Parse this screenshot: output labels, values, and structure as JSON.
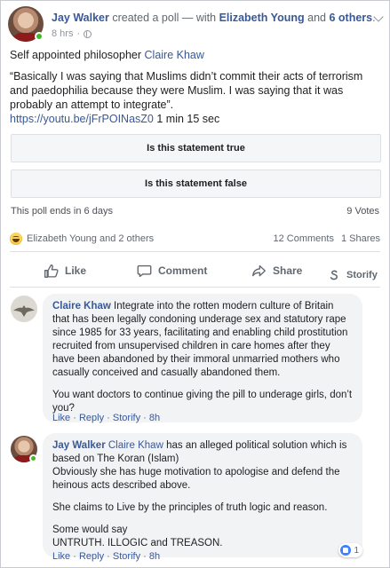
{
  "post": {
    "author": "Jay Walker",
    "action_text": "created a poll — with",
    "tagged_person": "Elizabeth Young",
    "and_text": "and",
    "tagged_others": "6 others",
    "period": ".",
    "time": "8 hrs",
    "separator": "·",
    "intro_text": "Self appointed philosopher",
    "intro_mention": "Claire Khaw",
    "quote": "“Basically I was saying that Muslims didn’t commit their acts of terrorism and paedophilia because they were Muslim. I was saying that it was probably an attempt to integrate”.",
    "link": "https://youtu.be/jFrPOINasZ0",
    "duration": "1 min 15 sec"
  },
  "poll": {
    "options": [
      "Is this statement true",
      "Is this statement false"
    ],
    "ends_text": "This poll ends in 6 days",
    "votes": "9 Votes"
  },
  "reactions": {
    "names": "Elizabeth Young and 2 others",
    "comments": "12 Comments",
    "shares": "1 Shares"
  },
  "actions": {
    "like": "Like",
    "comment": "Comment",
    "share": "Share",
    "storify": "Storify"
  },
  "comments": [
    {
      "author": "Claire Khaw",
      "text": "Integrate into the rotten modern culture of Britain that has been legally condoning underage sex and statutory rape since 1985 for 33 years, facilitating and enabling child prostitution recruited from unsupervised children in care homes after they have been abandoned by their immoral unmarried mothers who casually conceived and casually abandoned them.",
      "text2": "You want doctors to continue giving the pill to underage girls, don’t you?",
      "meta": {
        "like": "Like",
        "reply": "Reply",
        "storify": "Storify",
        "time": "8h",
        "dot": "·"
      }
    },
    {
      "author": "Jay Walker",
      "mention": "Claire Khaw",
      "line1_rest": "has an alleged political solution which is based on The Koran (Islam)",
      "line2": "Obviously she has huge motivation to apologise and defend the heinous acts described above.",
      "line3": "She claims to Live by the principles of truth logic and reason.",
      "line4a": "Some would say",
      "line4b": "UNTRUTH. ILLOGIC and TREASON.",
      "reaction_count": "1",
      "meta": {
        "like": "Like",
        "reply": "Reply",
        "storify": "Storify",
        "time": "8h",
        "dot": "·"
      }
    }
  ],
  "colors": {
    "link_blue": "#385898",
    "online_green": "#42b72a",
    "bubble_gray": "#f2f3f5"
  }
}
